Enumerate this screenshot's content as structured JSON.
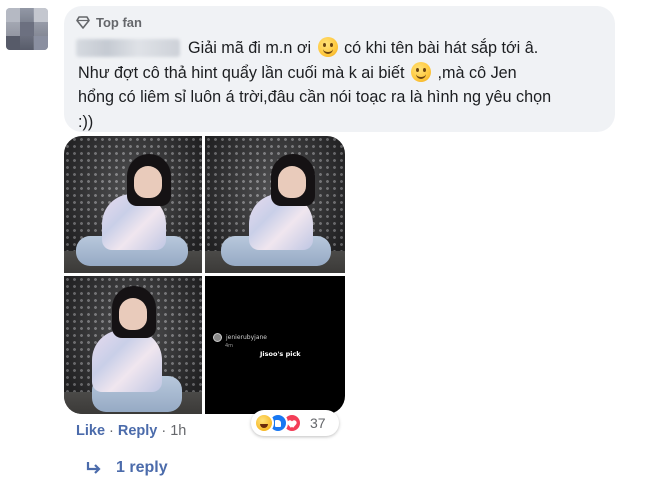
{
  "comment": {
    "badge_label": "Top fan",
    "badge_icon": "diamond-icon",
    "text_line1": "Giải mã đi m.n ơi",
    "text_line1b": "có khi tên bài hát sắp tới â.",
    "text_line2": "Như đợt cô thả hint quẩy lần cuối mà k ai biết",
    "text_line2b": ",mà cô Jen",
    "text_line3": "hổng có liêm sỉ luôn á trời,đâu cần nói toạc ra là hình ng yêu chọn",
    "text_line4": ":))",
    "emoji": "slightly-smiling-face-icon",
    "bubble_color": "#f0f2f5"
  },
  "attachment": {
    "story_username": "jenierubyjane",
    "story_sub": "4m",
    "story_caption": "Jisoo's pick"
  },
  "actions": {
    "like_label": "Like",
    "separator": "·",
    "reply_label": "Reply",
    "time": "1h",
    "link_color": "#4b6bab"
  },
  "reactions": {
    "icons": [
      "haha-icon",
      "like-icon",
      "love-icon"
    ],
    "count": "37"
  },
  "replies": {
    "icon": "reply-arrow-icon",
    "label": "1 reply"
  }
}
